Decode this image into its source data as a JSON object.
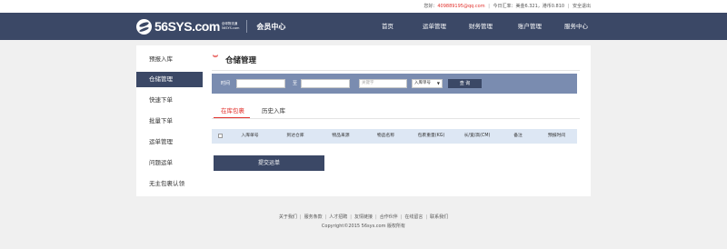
{
  "topbar": {
    "greeting": "您好：",
    "email": "409889195@qq.com",
    "rate": "今日汇率：美金6.321，港币0.810",
    "logout": "安全退出",
    "sep": "|"
  },
  "header": {
    "logo_text": "56SYS.com",
    "logo_small_1": "全球物流通",
    "logo_small_2": "56SYS.com",
    "member_center": "会员中心",
    "nav": [
      "首页",
      "运单管理",
      "财务管理",
      "账户管理",
      "服务中心"
    ]
  },
  "sidebar": {
    "items": [
      "预报入库",
      "仓储管理",
      "快速下单",
      "批量下单",
      "运单管理",
      "问题运单",
      "无主包裹认领"
    ],
    "active_index": 1
  },
  "main": {
    "title_icon": "double-chevron-down-icon",
    "title": "仓储管理",
    "search": {
      "time_label": "时间",
      "to_label": "至",
      "keyword_placeholder": "关键字",
      "select_value": "入库单号",
      "select_arrow": "▼",
      "query_button": "查 询"
    },
    "tabs": [
      "在库包裹",
      "历史入库"
    ],
    "active_tab": 0,
    "table_headers": [
      "入库单号",
      "到达仓库",
      "物品来源",
      "物品名称",
      "包裹重量(KG)",
      "长/宽/高(CM)",
      "备注",
      "预报时间"
    ],
    "submit_button": "提交运单"
  },
  "footer": {
    "links": [
      "关于我们",
      "服务条款",
      "人才招聘",
      "友情链接",
      "合作伙伴",
      "在线留言",
      "联系我们"
    ],
    "sep": "|",
    "copyright": "Copyright©2015 56sys.com 版权所有"
  },
  "colors": {
    "header_bg": "#3b4866",
    "search_bar_bg": "#7a8cb0",
    "accent_red": "#e2322d",
    "table_header_bg": "#dde7f4"
  }
}
